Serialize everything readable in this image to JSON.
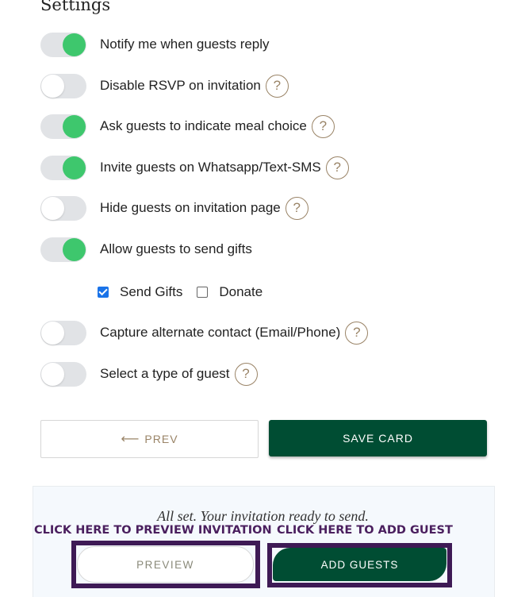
{
  "settings": {
    "title": "Settings",
    "toggles": [
      {
        "label": "Notify me when guests reply",
        "on": true,
        "help": false
      },
      {
        "label": "Disable RSVP on invitation",
        "on": false,
        "help": true
      },
      {
        "label": "Ask guests to indicate meal choice",
        "on": true,
        "help": true
      },
      {
        "label": "Invite guests on Whatsapp/Text-SMS",
        "on": true,
        "help": true
      },
      {
        "label": "Hide guests on invitation page",
        "on": false,
        "help": true
      },
      {
        "label": "Allow guests to send gifts",
        "on": true,
        "help": false
      },
      {
        "label": "Capture alternate contact (Email/Phone)",
        "on": false,
        "help": true
      },
      {
        "label": "Select a type of guest",
        "on": false,
        "help": true
      }
    ],
    "help_glyph": "?",
    "gift_options": [
      {
        "label": "Send Gifts",
        "checked": true
      },
      {
        "label": "Donate",
        "checked": false
      }
    ]
  },
  "buttons": {
    "prev_label": "PREV",
    "prev_arrow": "⟵",
    "save_label": "SAVE CARD",
    "preview_label": "PREVIEW",
    "add_guests_label": "ADD GUESTS"
  },
  "panel": {
    "ready_text": "All set. Your invitation ready to send."
  },
  "annotations": {
    "preview_hint": "CLICK HERE TO PREVIEW INVITATION",
    "add_guest_hint": "CLICK HERE TO ADD GUEST"
  },
  "colors": {
    "toggle_on": "#3ec76d",
    "toggle_track": "#e1e3e6",
    "primary_button": "#004d33",
    "accent_gold": "#9a8467",
    "annotation_purple": "#3e1a55",
    "checkbox_blue": "#1a73e8"
  }
}
